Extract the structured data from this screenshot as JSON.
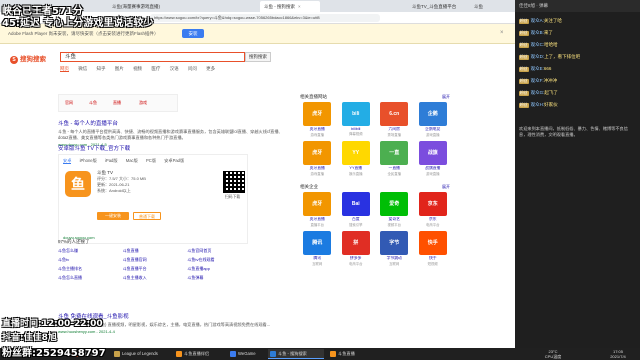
{
  "overlay": {
    "line1": "峡谷已王者571分",
    "line2": "45:延迟 专心上分游戏里说话较少",
    "bottom1": "直播时间:12:00-22:00",
    "bottom2": "抖音:佳佳8旭",
    "bottom3": "粉丝群:2529458797"
  },
  "browser": {
    "tabs": [
      "斗鱼(海量赛事游戏直播)",
      "斗鱼 - 搜狗搜索",
      "斗鱼TV_斗鱼直播平台",
      "斗鱼"
    ],
    "url": "https://www.sogou.com/tx?query=斗鱼&hdq=sogou-wsse-7056265bdacc1866&ekv=3&ie=utf8",
    "flash_message": "Adobe Flash Player 尚未安装，请尽快安装（点击安装进行更新Flash插件）",
    "flash_button": "安装",
    "back": "‹",
    "forward": "›",
    "refresh": "↻",
    "home": "⌂",
    "close": "×"
  },
  "search": {
    "logo": "搜狗搜索",
    "logo_mark": "S",
    "query": "斗鱼",
    "button": "搜狗搜索",
    "nav": [
      "网页",
      "微信",
      "知乎",
      "图片",
      "视频",
      "医疗",
      "汉语",
      "问问",
      "更多"
    ]
  },
  "tags": [
    "官网",
    "斗鱼",
    "直播",
    "游戏"
  ],
  "results": [
    {
      "title": "斗鱼 - 每个人的直播平台",
      "snippet": "斗鱼 - 每个人的直播平台提供高清、快捷、流畅的视频直播和游戏赛事直播服务，包含英雄联盟lol直播、穿越火线cf直播、dota2直播、美女直播等各类热门游戏赛事直播和各种热门手游直播。",
      "url": "www.douyu.com - 2021-4-5"
    },
    {
      "title": "斗鱼 免费在线观看_斗鱼影视",
      "snippet": "2021年4月7日 斗鱼 (斗鱼) 直播视频，明星影视，娱乐综艺，主播，电竞直播，热门游戏等高清视频免费在线观看...",
      "url": "www.huoshenyy.com - 2021-4-4"
    }
  ],
  "app_card": {
    "title": "安卓版斗鱼 TV下载_官方下载",
    "tabs": [
      "安卓",
      "iPhone版",
      "iPad版",
      "Mac版",
      "PC版",
      "安卓Pad版"
    ],
    "name": "斗鱼 TV",
    "rating": "评分：7.5/7   大小：75.0 MB",
    "date": "更新：2021-06-21",
    "system": "系统：Android以上",
    "download": "一键安装",
    "normal_download": "普通下载",
    "qr_label": "扫码下载",
    "icon": "鱼",
    "url": "douyu.sogou.com"
  },
  "related": {
    "title": "97%的人还搜了",
    "items": [
      "斗鱼怎么赚",
      "斗鱼直播",
      "斗鱼官网首页",
      "斗鱼tv",
      "斗鱼直播官网",
      "斗鱼tv在线观看",
      "斗鱼主播排名",
      "斗鱼直播平台",
      "斗鱼直播app",
      "斗鱼怎么直播",
      "斗鱼主播收入",
      "斗鱼弹幕"
    ]
  },
  "sidebar": {
    "live_title": "相关直播网站",
    "live_more": "展开",
    "live": [
      {
        "name": "虎牙直播",
        "sub": "游戏直播",
        "icon": "虎牙",
        "color": "#f29600"
      },
      {
        "name": "bilibili",
        "sub": "弹幕视频",
        "icon": "bili",
        "color": "#23ade5"
      },
      {
        "name": "六间房",
        "sub": "秀场直播",
        "icon": "6.cn",
        "color": "#e8502a"
      },
      {
        "name": "企鹅电竞",
        "sub": "游戏直播",
        "icon": "企鹅",
        "color": "#2e7dd7"
      },
      {
        "name": "虎牙直播",
        "sub": "游戏直播",
        "icon": "虎牙",
        "color": "#f29600"
      },
      {
        "name": "YY直播",
        "sub": "娱乐直播",
        "icon": "YY",
        "color": "#ffd800"
      },
      {
        "name": "一直播",
        "sub": "全民直播",
        "icon": "一直",
        "color": "#4caf50"
      },
      {
        "name": "战旗直播",
        "sub": "游戏直播",
        "icon": "战旗",
        "color": "#7b4dde"
      }
    ],
    "game_title": "相关企业",
    "game_more": "展开",
    "games": [
      {
        "name": "虎牙直播",
        "sub": "直播平台",
        "icon": "虎牙",
        "color": "#f29600"
      },
      {
        "name": "百度",
        "sub": "搜索引擎",
        "icon": "Bai",
        "color": "#2932e1"
      },
      {
        "name": "爱奇艺",
        "sub": "视频平台",
        "icon": "爱奇",
        "color": "#00be06"
      },
      {
        "name": "京东",
        "sub": "电商平台",
        "icon": "京东",
        "color": "#e1251b"
      },
      {
        "name": "腾讯",
        "sub": "互联网",
        "icon": "腾讯",
        "color": "#1b7be1"
      },
      {
        "name": "拼多多",
        "sub": "电商平台",
        "icon": "拼",
        "color": "#e02e24"
      },
      {
        "name": "字节跳动",
        "sub": "互联网",
        "icon": "字节",
        "color": "#325ab4"
      },
      {
        "name": "快手",
        "sub": "短视频",
        "icon": "快手",
        "color": "#ff5000"
      }
    ]
  },
  "chat": {
    "header": "佳佳8旭 · 弹幕",
    "messages": [
      {
        "badge": "粉丝",
        "name": "观众A:",
        "text": "关注了哈"
      },
      {
        "badge": "粉丝",
        "name": "观众B:",
        "text": "来了"
      },
      {
        "badge": "粉丝",
        "name": "观众C:",
        "text": "哈哈哈"
      },
      {
        "badge": "粉丝",
        "name": "观众D:",
        "text": "上了，看下排位吧"
      },
      {
        "badge": "粉丝",
        "name": "观众E:",
        "text": "666"
      },
      {
        "badge": "粉丝",
        "name": "观众F:",
        "text": "冲冲冲"
      },
      {
        "badge": "粉丝",
        "name": "观众G:",
        "text": "起飞了"
      },
      {
        "badge": "粉丝",
        "name": "观众H:",
        "text": "好家伙"
      }
    ],
    "notice": "欢迎来到本直播间，抵制低俗、暴力、色情、赌博等不良信息，理性消费，文明观看直播。"
  },
  "taskbar": {
    "items": [
      {
        "label": "佳佳8旭",
        "color": "#e8502a"
      },
      {
        "label": "League of Legends",
        "color": "#c8a24a"
      },
      {
        "label": "斗鱼直播伴侣",
        "color": "#f7941d"
      },
      {
        "label": "WeGame",
        "color": "#3b7cf0"
      },
      {
        "label": "斗鱼 - 搜狗搜索",
        "color": "#2e7dd7"
      },
      {
        "label": "斗鱼直播",
        "color": "#f7941d"
      }
    ],
    "weather": "23°C",
    "cpu": "CPU温度",
    "time": "17:05",
    "date": "2021/7/4"
  }
}
